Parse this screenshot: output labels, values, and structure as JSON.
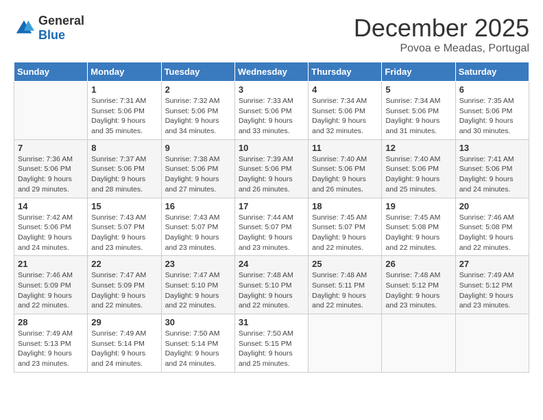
{
  "logo": {
    "general": "General",
    "blue": "Blue"
  },
  "title": "December 2025",
  "location": "Povoa e Meadas, Portugal",
  "headers": [
    "Sunday",
    "Monday",
    "Tuesday",
    "Wednesday",
    "Thursday",
    "Friday",
    "Saturday"
  ],
  "weeks": [
    [
      {
        "day": "",
        "info": ""
      },
      {
        "day": "1",
        "info": "Sunrise: 7:31 AM\nSunset: 5:06 PM\nDaylight: 9 hours\nand 35 minutes."
      },
      {
        "day": "2",
        "info": "Sunrise: 7:32 AM\nSunset: 5:06 PM\nDaylight: 9 hours\nand 34 minutes."
      },
      {
        "day": "3",
        "info": "Sunrise: 7:33 AM\nSunset: 5:06 PM\nDaylight: 9 hours\nand 33 minutes."
      },
      {
        "day": "4",
        "info": "Sunrise: 7:34 AM\nSunset: 5:06 PM\nDaylight: 9 hours\nand 32 minutes."
      },
      {
        "day": "5",
        "info": "Sunrise: 7:34 AM\nSunset: 5:06 PM\nDaylight: 9 hours\nand 31 minutes."
      },
      {
        "day": "6",
        "info": "Sunrise: 7:35 AM\nSunset: 5:06 PM\nDaylight: 9 hours\nand 30 minutes."
      }
    ],
    [
      {
        "day": "7",
        "info": "Sunrise: 7:36 AM\nSunset: 5:06 PM\nDaylight: 9 hours\nand 29 minutes."
      },
      {
        "day": "8",
        "info": "Sunrise: 7:37 AM\nSunset: 5:06 PM\nDaylight: 9 hours\nand 28 minutes."
      },
      {
        "day": "9",
        "info": "Sunrise: 7:38 AM\nSunset: 5:06 PM\nDaylight: 9 hours\nand 27 minutes."
      },
      {
        "day": "10",
        "info": "Sunrise: 7:39 AM\nSunset: 5:06 PM\nDaylight: 9 hours\nand 26 minutes."
      },
      {
        "day": "11",
        "info": "Sunrise: 7:40 AM\nSunset: 5:06 PM\nDaylight: 9 hours\nand 26 minutes."
      },
      {
        "day": "12",
        "info": "Sunrise: 7:40 AM\nSunset: 5:06 PM\nDaylight: 9 hours\nand 25 minutes."
      },
      {
        "day": "13",
        "info": "Sunrise: 7:41 AM\nSunset: 5:06 PM\nDaylight: 9 hours\nand 24 minutes."
      }
    ],
    [
      {
        "day": "14",
        "info": "Sunrise: 7:42 AM\nSunset: 5:06 PM\nDaylight: 9 hours\nand 24 minutes."
      },
      {
        "day": "15",
        "info": "Sunrise: 7:43 AM\nSunset: 5:07 PM\nDaylight: 9 hours\nand 23 minutes."
      },
      {
        "day": "16",
        "info": "Sunrise: 7:43 AM\nSunset: 5:07 PM\nDaylight: 9 hours\nand 23 minutes."
      },
      {
        "day": "17",
        "info": "Sunrise: 7:44 AM\nSunset: 5:07 PM\nDaylight: 9 hours\nand 23 minutes."
      },
      {
        "day": "18",
        "info": "Sunrise: 7:45 AM\nSunset: 5:07 PM\nDaylight: 9 hours\nand 22 minutes."
      },
      {
        "day": "19",
        "info": "Sunrise: 7:45 AM\nSunset: 5:08 PM\nDaylight: 9 hours\nand 22 minutes."
      },
      {
        "day": "20",
        "info": "Sunrise: 7:46 AM\nSunset: 5:08 PM\nDaylight: 9 hours\nand 22 minutes."
      }
    ],
    [
      {
        "day": "21",
        "info": "Sunrise: 7:46 AM\nSunset: 5:09 PM\nDaylight: 9 hours\nand 22 minutes."
      },
      {
        "day": "22",
        "info": "Sunrise: 7:47 AM\nSunset: 5:09 PM\nDaylight: 9 hours\nand 22 minutes."
      },
      {
        "day": "23",
        "info": "Sunrise: 7:47 AM\nSunset: 5:10 PM\nDaylight: 9 hours\nand 22 minutes."
      },
      {
        "day": "24",
        "info": "Sunrise: 7:48 AM\nSunset: 5:10 PM\nDaylight: 9 hours\nand 22 minutes."
      },
      {
        "day": "25",
        "info": "Sunrise: 7:48 AM\nSunset: 5:11 PM\nDaylight: 9 hours\nand 22 minutes."
      },
      {
        "day": "26",
        "info": "Sunrise: 7:48 AM\nSunset: 5:12 PM\nDaylight: 9 hours\nand 23 minutes."
      },
      {
        "day": "27",
        "info": "Sunrise: 7:49 AM\nSunset: 5:12 PM\nDaylight: 9 hours\nand 23 minutes."
      }
    ],
    [
      {
        "day": "28",
        "info": "Sunrise: 7:49 AM\nSunset: 5:13 PM\nDaylight: 9 hours\nand 23 minutes."
      },
      {
        "day": "29",
        "info": "Sunrise: 7:49 AM\nSunset: 5:14 PM\nDaylight: 9 hours\nand 24 minutes."
      },
      {
        "day": "30",
        "info": "Sunrise: 7:50 AM\nSunset: 5:14 PM\nDaylight: 9 hours\nand 24 minutes."
      },
      {
        "day": "31",
        "info": "Sunrise: 7:50 AM\nSunset: 5:15 PM\nDaylight: 9 hours\nand 25 minutes."
      },
      {
        "day": "",
        "info": ""
      },
      {
        "day": "",
        "info": ""
      },
      {
        "day": "",
        "info": ""
      }
    ]
  ]
}
